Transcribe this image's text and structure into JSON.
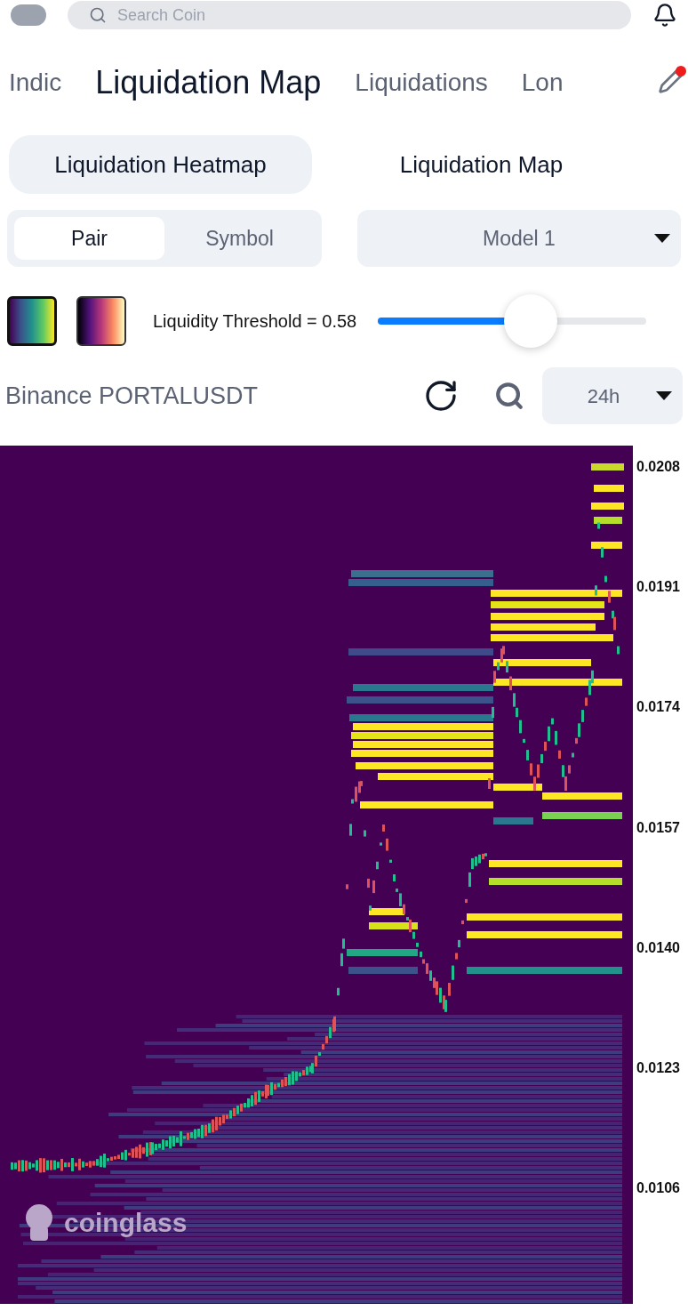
{
  "search": {
    "placeholder": "Search Coin"
  },
  "tabs": [
    {
      "label": "Indic",
      "selected": false
    },
    {
      "label": "Liquidation Map",
      "selected": true
    },
    {
      "label": "Liquidations",
      "selected": false
    },
    {
      "label": "Lon",
      "selected": false
    }
  ],
  "edit_badge": {
    "on": true
  },
  "subtabs": [
    {
      "label": "Liquidation Heatmap",
      "selected": true
    },
    {
      "label": "Liquidation Map",
      "selected": false
    }
  ],
  "segments": [
    {
      "label": "Pair",
      "selected": true
    },
    {
      "label": "Symbol",
      "selected": false
    }
  ],
  "model_select": {
    "value": "Model 1"
  },
  "palettes": [
    {
      "kind": "viridis",
      "selected": true
    },
    {
      "kind": "magma",
      "selected": false
    }
  ],
  "threshold": {
    "label": "Liquidity Threshold = 0.58",
    "level": 0.57
  },
  "chart_header": {
    "title": "Binance PORTALUSDT",
    "period": "24h"
  },
  "price_axis_labels": [
    "0.0208",
    "0.0191",
    "0.0174",
    "0.0157",
    "0.0140",
    "0.0123",
    "0.0106"
  ],
  "brand": "coinglass"
}
